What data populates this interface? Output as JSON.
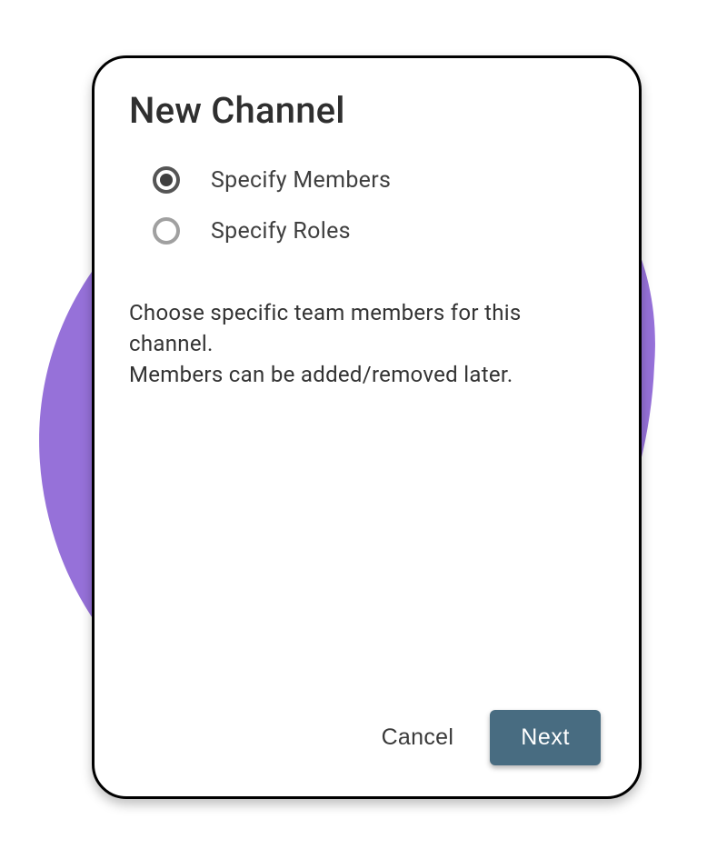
{
  "title": "New Channel",
  "radio_options": [
    {
      "label": "Specify Members",
      "selected": true
    },
    {
      "label": "Specify Roles",
      "selected": false
    }
  ],
  "description": "Choose specific team members for this\nchannel.\nMembers can be added/removed later.",
  "buttons": {
    "cancel": "Cancel",
    "next": "Next"
  },
  "colors": {
    "accent_purple": "#9671d9",
    "button_primary": "#486c81"
  }
}
